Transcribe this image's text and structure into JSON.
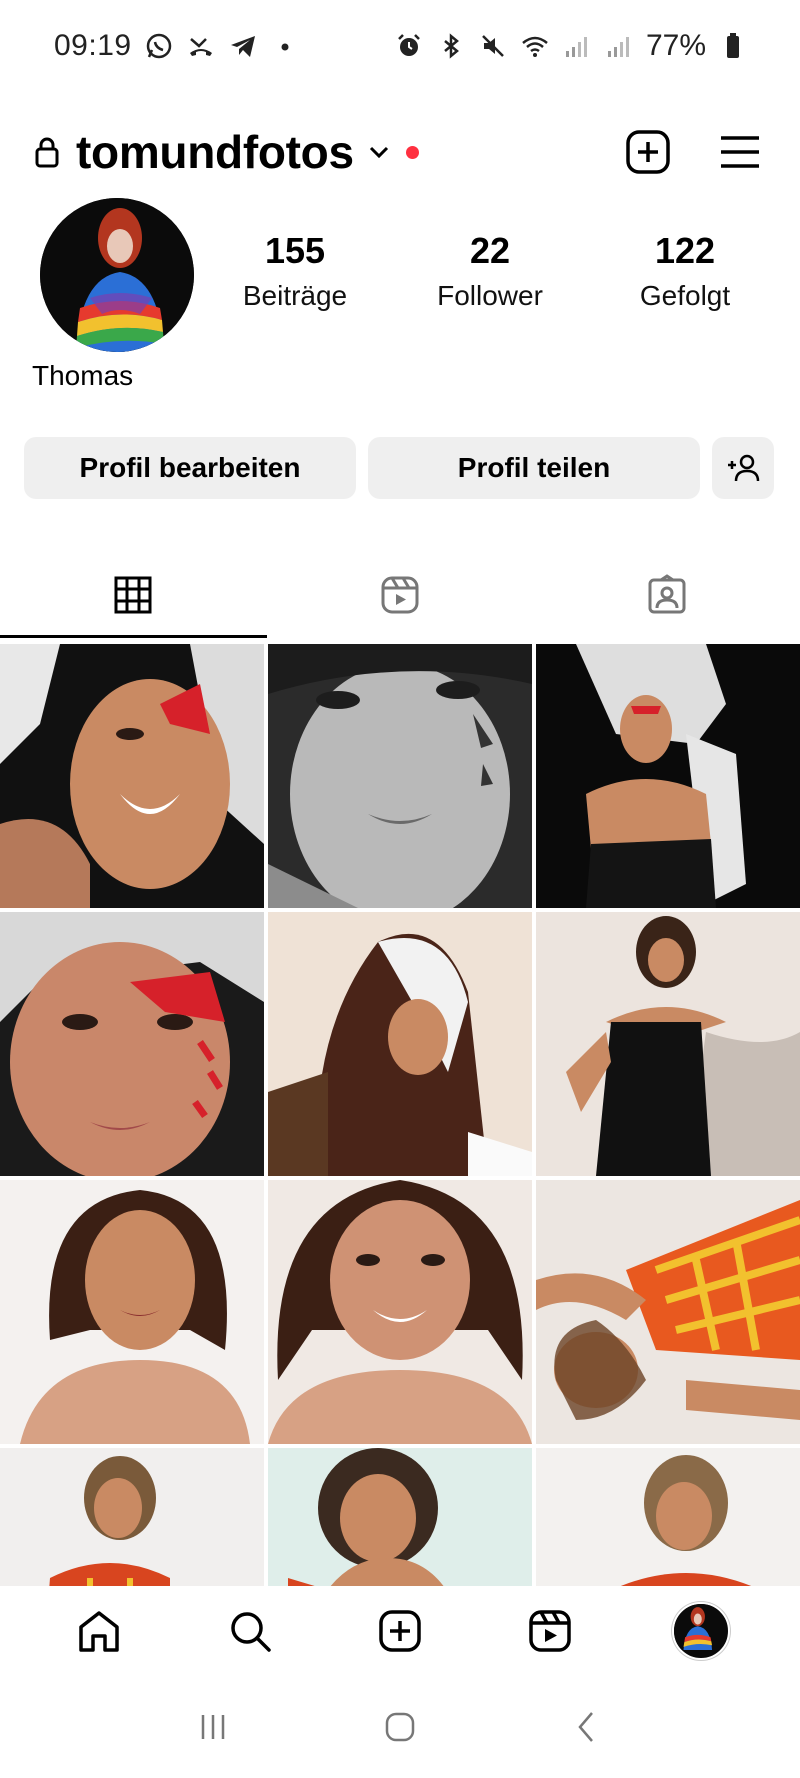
{
  "status_bar": {
    "time": "09:19",
    "battery_text": "77%",
    "left_icons": [
      "whatsapp-icon",
      "missed-call-icon",
      "telegram-icon",
      "dot-icon"
    ],
    "right_icons": [
      "alarm-icon",
      "bluetooth-icon",
      "mute-icon",
      "wifi-icon",
      "signal-icon",
      "signal-icon",
      "battery-icon"
    ]
  },
  "header": {
    "username": "tomundfotos",
    "lock_icon": "lock-icon",
    "chevron_icon": "chevron-down-icon",
    "notification_dot_color": "#ff3040",
    "create_icon": "plus-square-icon",
    "menu_icon": "hamburger-menu-icon"
  },
  "profile": {
    "display_name": "Thomas",
    "stats": [
      {
        "value": "155",
        "label": "Beiträge"
      },
      {
        "value": "22",
        "label": "Follower"
      },
      {
        "value": "122",
        "label": "Gefolgt"
      }
    ]
  },
  "actions": {
    "edit_label": "Profil bearbeiten",
    "share_label": "Profil teilen",
    "discover_icon": "add-person-icon"
  },
  "tabs": [
    {
      "icon": "grid-icon",
      "active": true
    },
    {
      "icon": "reels-icon",
      "active": false
    },
    {
      "icon": "tagged-icon",
      "active": false
    }
  ],
  "grid": {
    "posts": [
      "photo-feather-red-lashes-smiling",
      "photo-bw-closeup-face",
      "photo-feather-boa-black-dress",
      "photo-feather-red-eye-closeup",
      "photo-headscarf-portrait",
      "photo-black-dress-pose",
      "photo-bob-hair-portrait",
      "photo-smiling-bob-hair",
      "photo-plaid-shirt-lying",
      "photo-plaid-top-portrait",
      "photo-plaid-top-closeup",
      "photo-plaid-top-smiling"
    ]
  },
  "bottom_nav": {
    "items": [
      "home-icon",
      "search-icon",
      "create-icon",
      "reels-icon",
      "profile-avatar"
    ]
  },
  "system_nav": {
    "items": [
      "recent-apps-icon",
      "home-button-icon",
      "back-icon"
    ]
  },
  "colors": {
    "button_bg": "#efefef",
    "accent_red": "#ff3040"
  }
}
